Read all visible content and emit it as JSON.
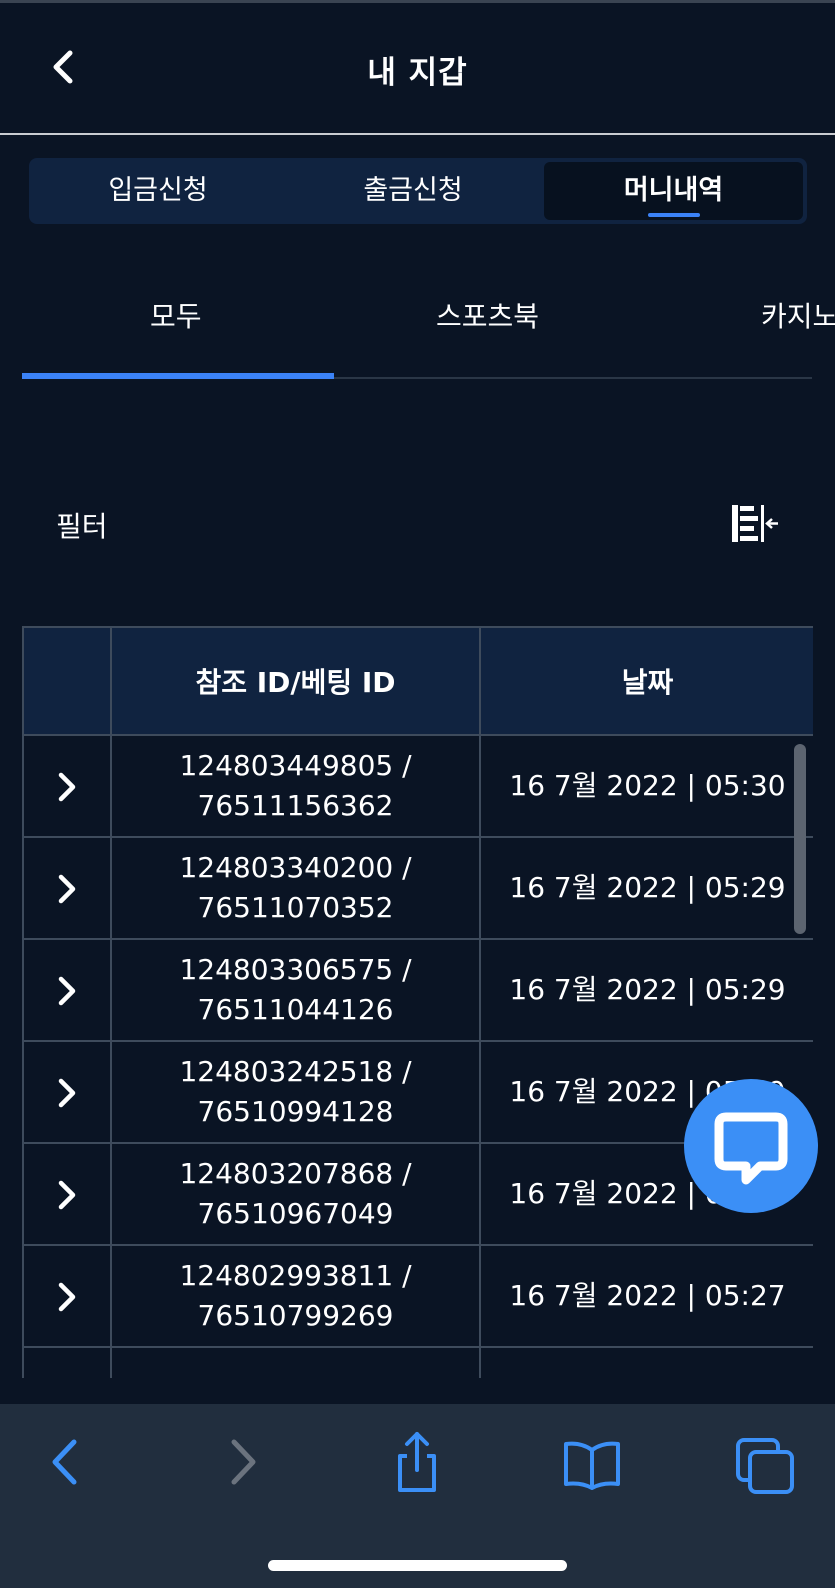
{
  "header": {
    "title": "내 지갑",
    "back_icon": "chevron-left-icon"
  },
  "segments": [
    {
      "label": "입금신청",
      "active": false
    },
    {
      "label": "출금신청",
      "active": false
    },
    {
      "label": "머니내역",
      "active": true
    }
  ],
  "tabs": [
    {
      "label": "모두",
      "active": true
    },
    {
      "label": "스포츠북",
      "active": false
    },
    {
      "label": "카지노",
      "active": false
    }
  ],
  "filter": {
    "label": "필터",
    "icon": "filter-collapse-icon"
  },
  "table": {
    "headers": [
      "",
      "참조 ID/베팅 ID",
      "날짜"
    ],
    "rows": [
      {
        "ref": "124803449805 /",
        "bet": "76511156362",
        "date": "16 7월 2022 | 05:30"
      },
      {
        "ref": "124803340200 /",
        "bet": "76511070352",
        "date": "16 7월 2022 | 05:29"
      },
      {
        "ref": "124803306575 /",
        "bet": "76511044126",
        "date": "16 7월 2022 | 05:29"
      },
      {
        "ref": "124803242518 /",
        "bet": "76510994128",
        "date": "16 7월 2022 | 05:29"
      },
      {
        "ref": "124803207868 /",
        "bet": "76510967049",
        "date": "16 7월 2022 | 05:29"
      },
      {
        "ref": "124802993811 /",
        "bet": "76510799269",
        "date": "16 7월 2022 | 05:27"
      }
    ]
  },
  "chat": {
    "icon": "chat-bubble-icon"
  },
  "browser_bar": {
    "icons": [
      "back-arrow-icon",
      "forward-arrow-icon",
      "share-icon",
      "bookmarks-icon",
      "tabs-icon"
    ]
  },
  "colors": {
    "background": "#0a1424",
    "accent": "#3b82f6",
    "panel": "#102340",
    "toolbar": "#212e3e"
  }
}
